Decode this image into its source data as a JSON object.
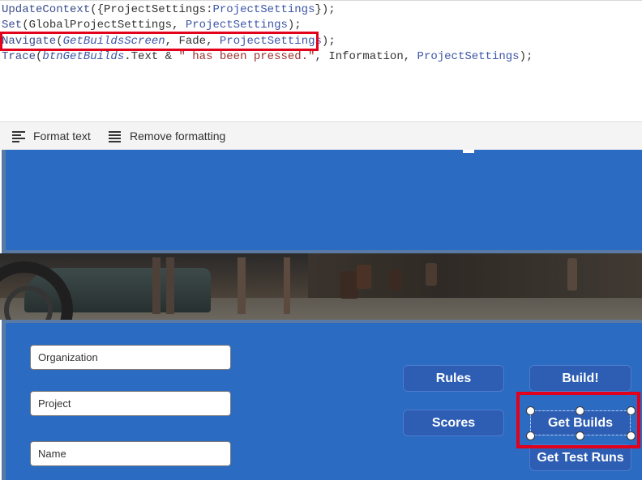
{
  "editor": {
    "lines": [
      [
        {
          "t": "UpdateContext",
          "c": "tok-fn"
        },
        {
          "t": "({",
          "c": "tok-plain"
        },
        {
          "t": "ProjectSettings",
          "c": "tok-plain"
        },
        {
          "t": ":",
          "c": "tok-plain"
        },
        {
          "t": "ProjectSettings",
          "c": "tok-var"
        },
        {
          "t": "});",
          "c": "tok-plain"
        }
      ],
      [
        {
          "t": "Set",
          "c": "tok-fn"
        },
        {
          "t": "(",
          "c": "tok-plain"
        },
        {
          "t": "GlobalProjectSettings",
          "c": "tok-plain"
        },
        {
          "t": ", ",
          "c": "tok-plain"
        },
        {
          "t": "ProjectSettings",
          "c": "tok-var"
        },
        {
          "t": ");",
          "c": "tok-plain"
        }
      ],
      [
        {
          "t": "Navigate",
          "c": "tok-fn"
        },
        {
          "t": "(",
          "c": "tok-plain"
        },
        {
          "t": "GetBuildsScreen",
          "c": "tok-ital"
        },
        {
          "t": ", ",
          "c": "tok-plain"
        },
        {
          "t": "Fade",
          "c": "tok-plain"
        },
        {
          "t": ", ",
          "c": "tok-plain"
        },
        {
          "t": "ProjectSettings",
          "c": "tok-var"
        },
        {
          "t": ");",
          "c": "tok-plain"
        }
      ],
      [
        {
          "t": "Trace",
          "c": "tok-fn"
        },
        {
          "t": "(",
          "c": "tok-plain"
        },
        {
          "t": "btnGetBuilds",
          "c": "tok-ital"
        },
        {
          "t": ".Text & ",
          "c": "tok-plain"
        },
        {
          "t": "\" has been pressed.\"",
          "c": "tok-str"
        },
        {
          "t": ", ",
          "c": "tok-plain"
        },
        {
          "t": "Information",
          "c": "tok-plain"
        },
        {
          "t": ", ",
          "c": "tok-plain"
        },
        {
          "t": "ProjectSettings",
          "c": "tok-var"
        },
        {
          "t": ");",
          "c": "tok-plain"
        }
      ]
    ]
  },
  "toolbar": {
    "format_text": "Format text",
    "remove_formatting": "Remove formatting"
  },
  "form": {
    "organization_placeholder": "Organization",
    "project_placeholder": "Project",
    "name_placeholder": "Name"
  },
  "buttons": {
    "rules": "Rules",
    "build": "Build!",
    "scores": "Scores",
    "get_builds": "Get Builds",
    "get_test_runs": "Get Test Runs"
  },
  "colors": {
    "canvas_blue": "#2b6bc2",
    "button_blue": "#2e5eb3",
    "highlight_red": "#e3001b"
  }
}
